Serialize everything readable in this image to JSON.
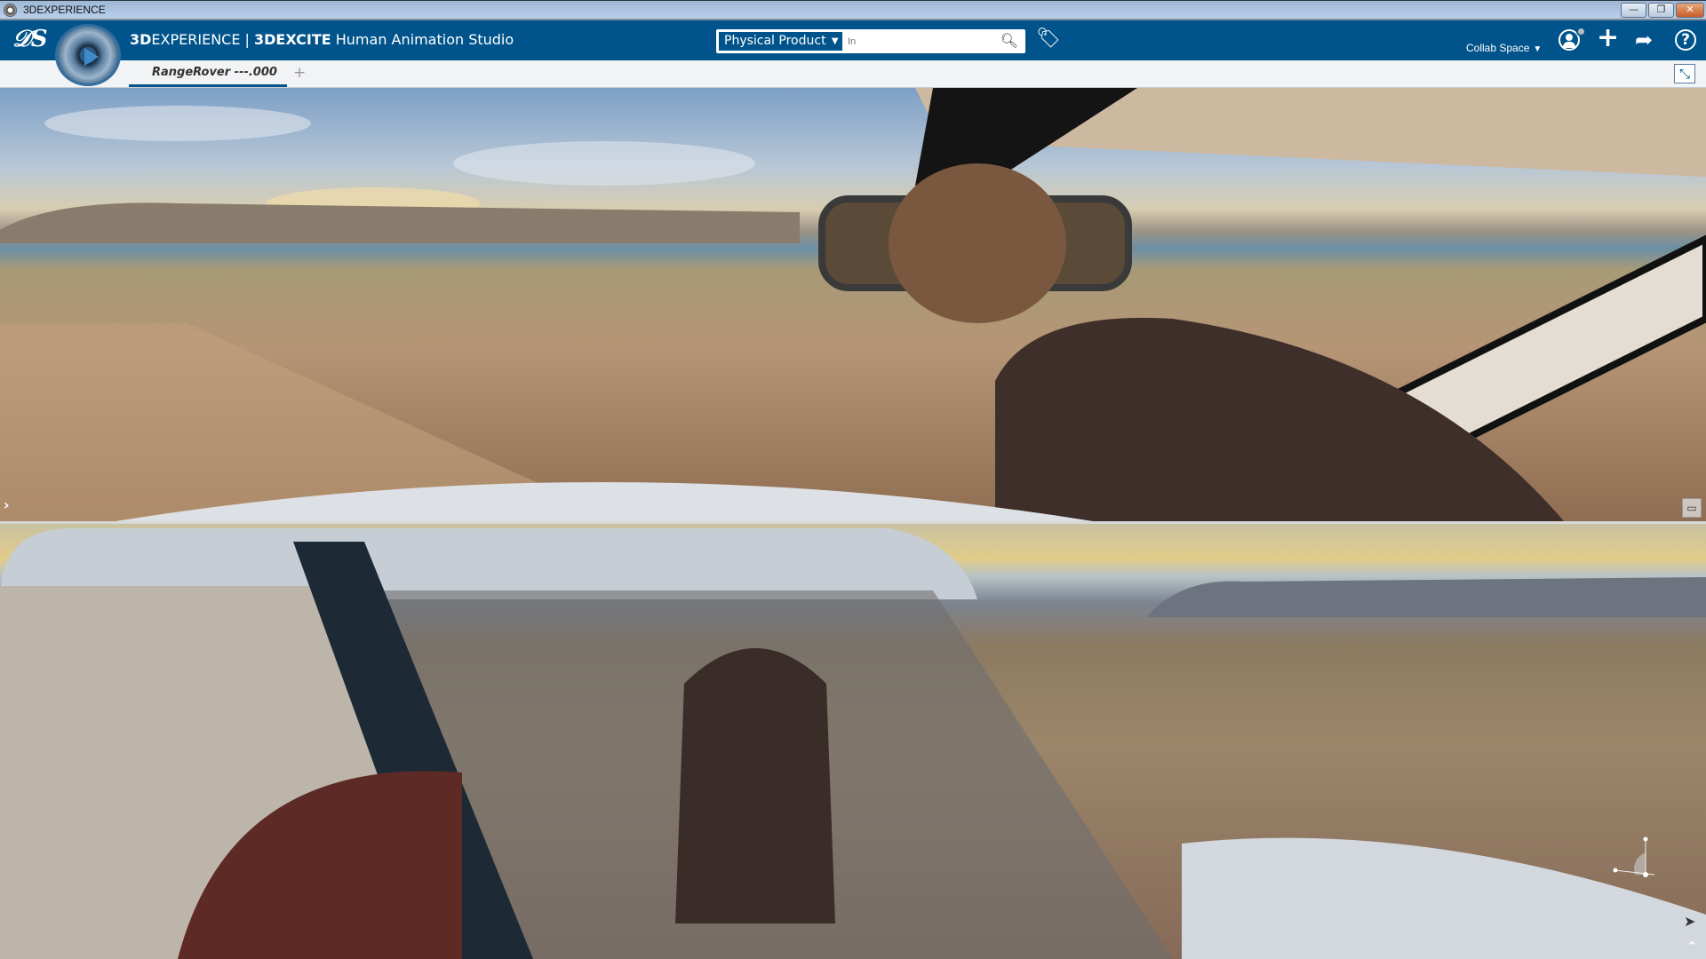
{
  "window": {
    "title": "3DEXPERIENCE",
    "controls": [
      "minimize",
      "restore",
      "close"
    ]
  },
  "header": {
    "brand_prefix": "3D",
    "brand_rest": "EXPERIENCE",
    "separator": " | ",
    "product_bold": "3DEXCITE",
    "product_rest": " Human Animation Studio",
    "search": {
      "scope": "Physical Product",
      "placeholder": "In"
    },
    "collab_space": "Collab Space",
    "icons": [
      "compass-icon",
      "search-icon",
      "tag-icon",
      "user-icon",
      "plus-icon",
      "share-icon",
      "help-icon"
    ]
  },
  "tabs": [
    {
      "label": "RangeRover ---.000",
      "active": true
    }
  ],
  "add_tab_label": "+",
  "colors": {
    "brand_blue": "#00548b",
    "tab_bar": "#f1f3f5"
  }
}
